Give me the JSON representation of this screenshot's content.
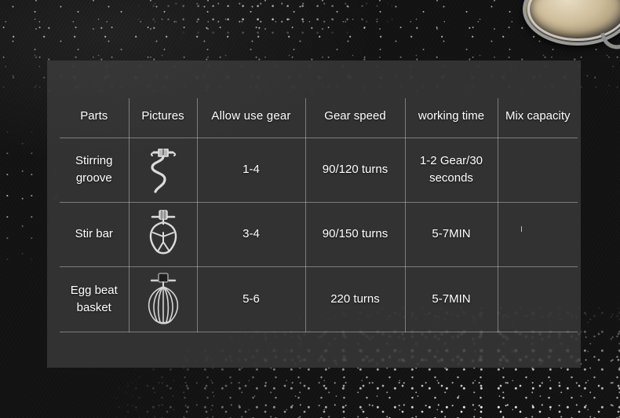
{
  "scene": {
    "background_color": "#141414",
    "panel_color": "#484848",
    "line_color": "#d8d8d8",
    "text_color": "#ffffff"
  },
  "props": {
    "bowl_label": "mixing-bowl-with-batter",
    "flour_label": "scattered-flour"
  },
  "table": {
    "headers": [
      "Parts",
      "Pictures",
      "Allow use  gear",
      "Gear speed",
      "working time",
      "Mix capacity"
    ],
    "rows": [
      {
        "parts": "Stirring groove",
        "picture_icon": "dough-hook-icon",
        "allow_use_gear": "1-4",
        "gear_speed": "90/120 turns",
        "working_time": "1-2 Gear/30 seconds",
        "working_time_wraps": true,
        "mix_capacity": ""
      },
      {
        "parts": "Stir bar",
        "picture_icon": "flat-beater-icon",
        "allow_use_gear": "3-4",
        "gear_speed": "90/150 turns",
        "working_time": "5-7MIN",
        "working_time_wraps": false,
        "mix_capacity": ""
      },
      {
        "parts": "Egg beat basket",
        "picture_icon": "balloon-whisk-icon",
        "allow_use_gear": "5-6",
        "gear_speed": "220 turns",
        "working_time": "5-7MIN",
        "working_time_wraps": false,
        "mix_capacity": ""
      }
    ]
  }
}
